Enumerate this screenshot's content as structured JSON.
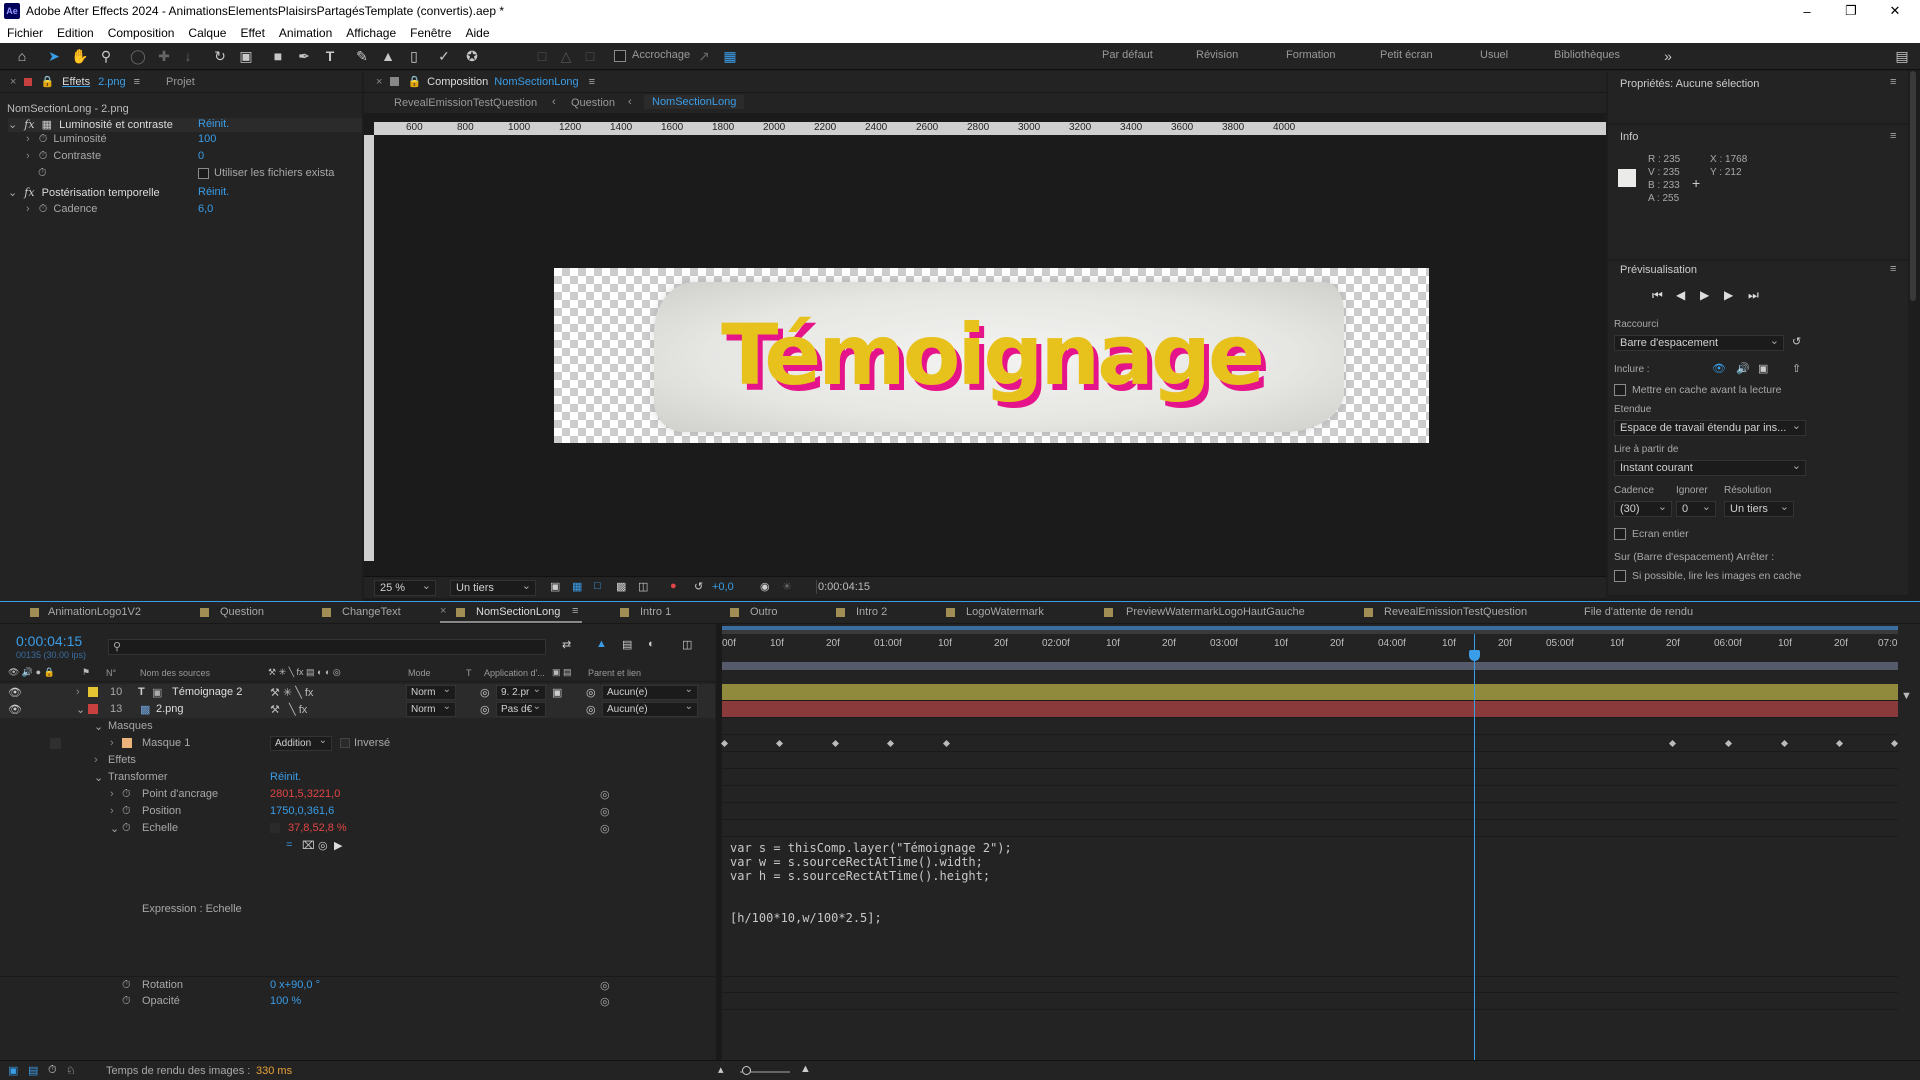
{
  "window": {
    "title": "Adobe After Effects 2024 - AnimationsElementsPlaisirsPartagésTemplate (convertis).aep *",
    "app_icon": "Ae"
  },
  "menu": [
    "Fichier",
    "Edition",
    "Composition",
    "Calque",
    "Effet",
    "Animation",
    "Affichage",
    "Fenêtre",
    "Aide"
  ],
  "toolbar": {
    "snap_label": "Accrochage",
    "workspaces": [
      "Par défaut",
      "Révision",
      "Formation",
      "Petit écran",
      "Usuel",
      "Bibliothèques"
    ]
  },
  "effects_panel": {
    "tab_label": "Effets",
    "tab_file": "2.png",
    "tab_project": "Projet",
    "header": "NomSectionLong - 2.png",
    "effects": [
      {
        "name": "Luminosité et contraste",
        "reset": "Réinit.",
        "params": [
          {
            "name": "Luminosité",
            "value": "100"
          },
          {
            "name": "Contraste",
            "value": "0"
          }
        ],
        "checkbox_label": "Utiliser les fichiers exista"
      },
      {
        "name": "Postérisation temporelle",
        "reset": "Réinit.",
        "params": [
          {
            "name": "Cadence",
            "value": "6,0"
          }
        ]
      }
    ]
  },
  "composition_panel": {
    "tab_label": "Composition",
    "comp_name": "NomSectionLong",
    "breadcrumbs": [
      "RevealEmissionTestQuestion",
      "Question",
      "NomSectionLong"
    ],
    "ruler_ticks": [
      "600",
      "800",
      "1000",
      "1200",
      "1400",
      "1600",
      "1800",
      "2000",
      "2200",
      "2400",
      "2600",
      "2800",
      "3000",
      "3200",
      "3400",
      "3600",
      "3800",
      "4000"
    ],
    "preview_text": "Témoignage",
    "zoom": "25 %",
    "resolution": "Un tiers",
    "exposure": "+0,0",
    "timecode": "0:00:04:15"
  },
  "properties_panel": {
    "title": "Propriétés: Aucune sélection"
  },
  "info_panel": {
    "title": "Info",
    "r": "R : 235",
    "v": "V : 235",
    "b": "B : 233",
    "a": "A : 255",
    "x": "X : 1768",
    "y": "Y : 212"
  },
  "preview_panel": {
    "title": "Prévisualisation",
    "shortcut_label": "Raccourci",
    "shortcut_value": "Barre d'espacement",
    "include_label": "Inclure :",
    "cache_label": "Mettre en cache avant la lecture",
    "range_label": "Etendue",
    "range_value": "Espace de travail étendu par ins...",
    "play_from_label": "Lire à partir de",
    "play_from_value": "Instant courant",
    "cadence_label": "Cadence",
    "ignore_label": "Ignorer",
    "resolution_label": "Résolution",
    "cadence_value": "(30)",
    "ignore_value": "0",
    "resolution_value": "Un tiers",
    "fullscreen_label": "Ecran entier",
    "stop_label": "Sur (Barre d'espacement) Arrêter :",
    "cached_label": "Si possible, lire les images en cache"
  },
  "timeline": {
    "tabs": [
      "AnimationLogo1V2",
      "Question",
      "ChangeText",
      "NomSectionLong",
      "Intro 1",
      "Outro",
      "Intro 2",
      "LogoWatermark",
      "PreviewWatermarkLogoHautGauche",
      "RevealEmissionTestQuestion",
      "File d'attente de rendu"
    ],
    "active_tab": "NomSectionLong",
    "timecode": "0:00:04:15",
    "frame_info": "00135 (30.00 ips)",
    "col_source": "Nom des sources",
    "col_num": "N°",
    "col_mode": "Mode",
    "col_t": "T",
    "col_app": "Application d'...",
    "col_parent": "Parent et lien",
    "ruler": [
      "00f",
      "10f",
      "20f",
      "01:00f",
      "10f",
      "20f",
      "02:00f",
      "10f",
      "20f",
      "03:00f",
      "10f",
      "20f",
      "04:00f",
      "10f",
      "20f",
      "05:00f",
      "10f",
      "20f",
      "06:00f",
      "10f",
      "20f",
      "07:0"
    ],
    "layers": [
      {
        "num": "10",
        "type": "T",
        "name": "Témoignage 2",
        "mode": "Norm",
        "app": "9. 2.pr",
        "parent": "Aucun(e)",
        "color": "#e6c532"
      },
      {
        "num": "13",
        "type": "img",
        "name": "2.png",
        "mode": "Norm",
        "app": "Pas d€",
        "parent": "Aucun(e)",
        "color": "#c94040"
      }
    ],
    "masks_label": "Masques",
    "mask1_label": "Masque 1",
    "mask_mode": "Addition",
    "inverted_label": "Inversé",
    "effects_label": "Effets",
    "transform_label": "Transformer",
    "reset_label": "Réinit.",
    "anchor_label": "Point d'ancrage",
    "anchor_value": "2801,5,3221,0",
    "position_label": "Position",
    "position_value": "1750,0,361,6",
    "scale_label": "Echelle",
    "scale_value": "37,8,52,8 %",
    "expression_label": "Expression : Echelle",
    "expression_code": "var s = thisComp.layer(\"Témoignage 2\");\nvar w = s.sourceRectAtTime().width;\nvar h = s.sourceRectAtTime().height;\n\n\n[h/100*10,w/100*2.5];",
    "rotation_label": "Rotation",
    "rotation_value": "0 x+90,0 °",
    "opacity_label": "Opacité",
    "opacity_value": "100 %",
    "render_time_label": "Temps de rendu des images :",
    "render_time_value": "330 ms"
  },
  "colors": {
    "accent_blue": "#3a9de8",
    "value_red": "#e24545",
    "text_yellow": "#e8c21c",
    "text_pink": "#e6148a",
    "layer_olive": "#8f8a3c",
    "layer_maroon": "#8a3a3a"
  }
}
